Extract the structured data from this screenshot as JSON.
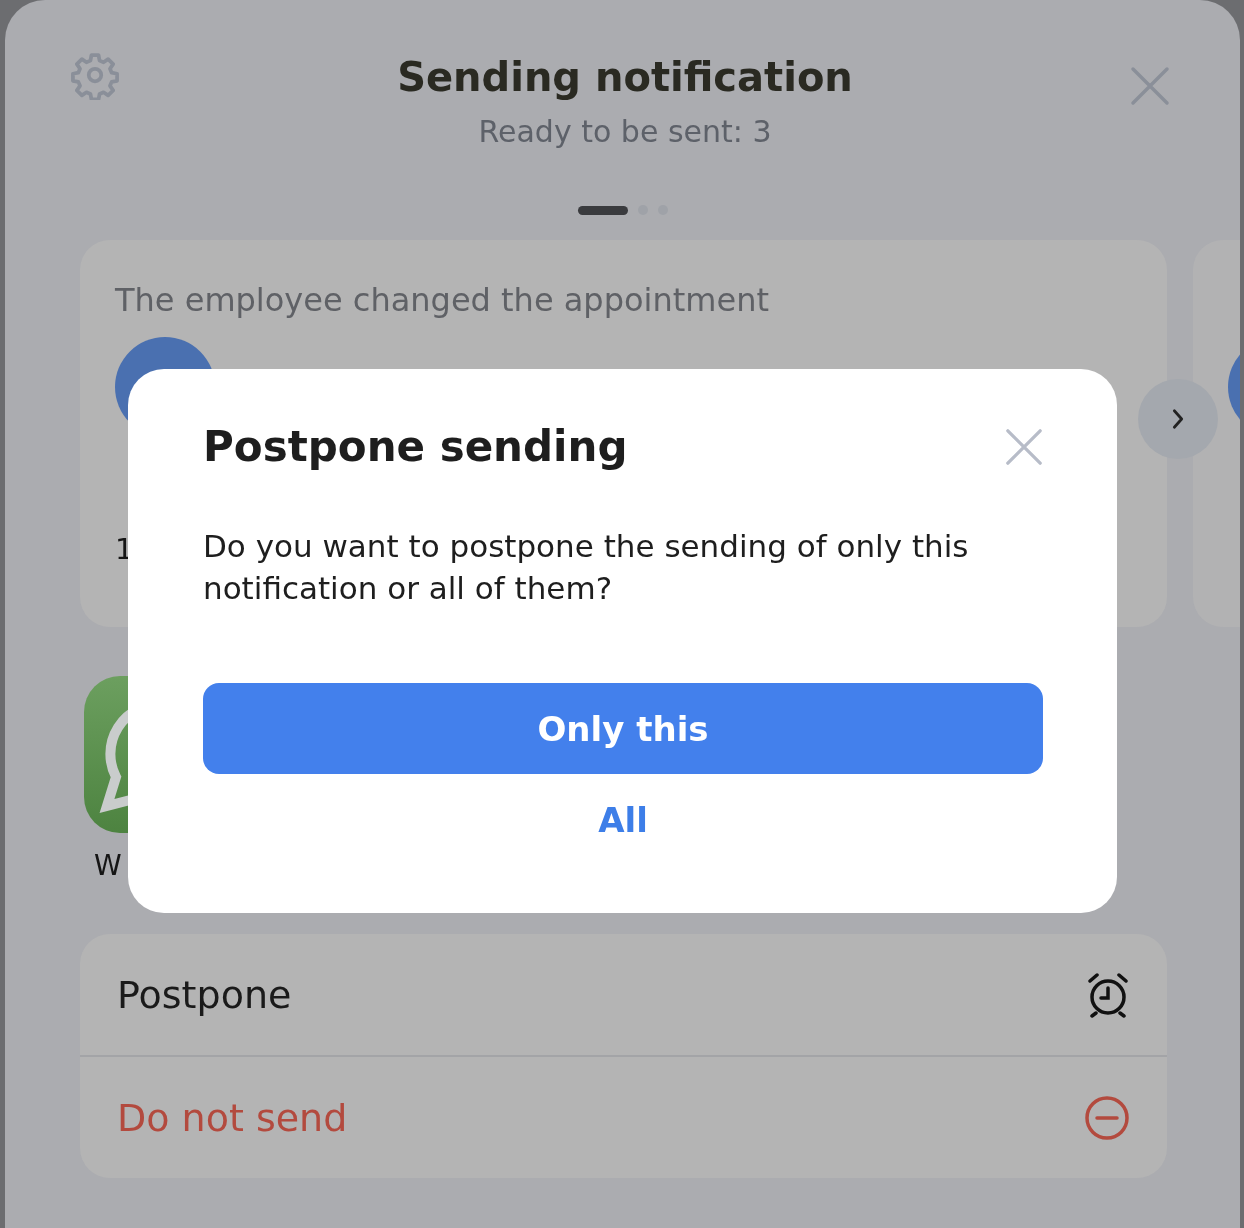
{
  "header": {
    "title": "Sending notification",
    "subtitle": "Ready to be sent: 3"
  },
  "pager": [
    {
      "selected": true
    },
    {
      "selected": false
    },
    {
      "selected": false
    }
  ],
  "cards": [
    {
      "kind": "full",
      "title": "The employee changed the appointment",
      "lines": [
        "1"
      ]
    },
    {
      "kind": "peek"
    }
  ],
  "channels": [
    {
      "label": "W"
    }
  ],
  "actions": [
    {
      "label": "Postpone",
      "kind": "postpone"
    },
    {
      "label": "Do not send",
      "kind": "cancel"
    }
  ],
  "dialog": {
    "title": "Postpone sending",
    "message": "Do you want to postpone the sending of only this notification or all of them?",
    "buttons": [
      {
        "label": "Only this",
        "kind": "primary"
      },
      {
        "label": "All",
        "kind": "link"
      }
    ]
  }
}
